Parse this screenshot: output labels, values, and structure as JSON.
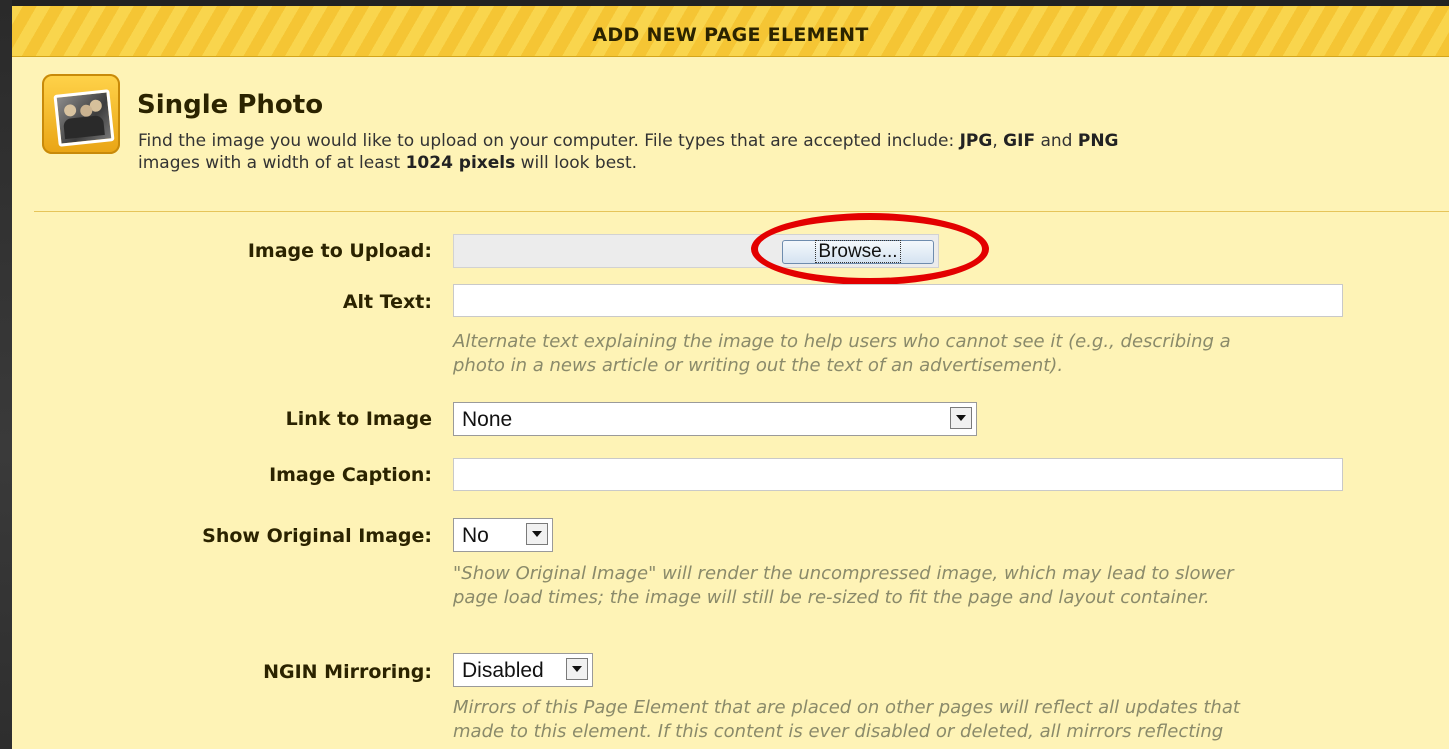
{
  "dialog": {
    "title": "ADD NEW PAGE ELEMENT"
  },
  "section": {
    "icon": "photo-icon",
    "title": "Single Photo",
    "desc_prefix": "Find the image you would like to upload on your computer. File types that are accepted include: ",
    "type_jpg": "JPG",
    "sep1": ", ",
    "type_gif": "GIF",
    "sep2": " and ",
    "type_png": "PNG",
    "desc_line2_prefix": "images with a width of at least ",
    "min_width": "1024 pixels",
    "desc_line2_suffix": " will look best."
  },
  "form": {
    "image_upload": {
      "label": "Image to Upload:",
      "browse_label": "Browse..."
    },
    "alt_text": {
      "label": "Alt Text:",
      "value": "",
      "help_line1": "Alternate text explaining the image to help users who cannot see it (e.g., describing a",
      "help_line2": "photo in a news article or writing out the text of an advertisement)."
    },
    "link_to_image": {
      "label": "Link to Image",
      "selected": "None"
    },
    "image_caption": {
      "label": "Image Caption:",
      "value": ""
    },
    "show_original": {
      "label": "Show Original Image:",
      "selected": "No",
      "help_line1": "\"Show Original Image\" will render the uncompressed image, which may lead to slower",
      "help_line2": "page load times; the image will still be re-sized to fit the page and layout container."
    },
    "ngin_mirroring": {
      "label": "NGIN Mirroring:",
      "selected": "Disabled",
      "help_line1": "Mirrors of this Page Element that are placed on other pages will reflect all updates that",
      "help_line2": "made to this element. If this content is ever disabled or deleted, all mirrors reflecting"
    }
  },
  "colors": {
    "panel_bg": "#fef3b6",
    "header_stripe": "#f5c534",
    "highlight": "#e30000"
  }
}
